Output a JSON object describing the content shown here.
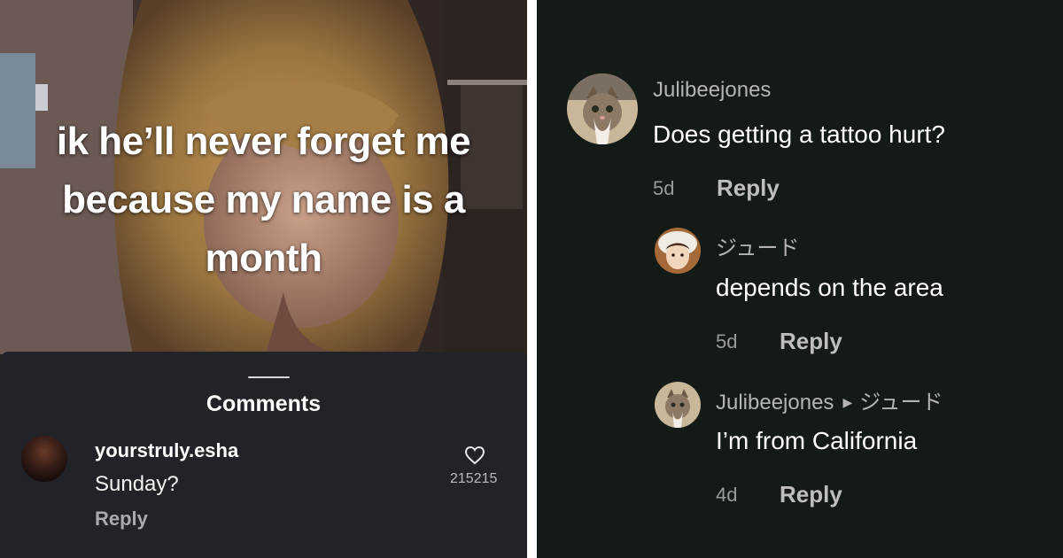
{
  "left_panel": {
    "caption_lines": [
      "ik he’ll never forget me",
      "because my name is a",
      "month"
    ],
    "comments_sheet": {
      "title": "Comments",
      "comment": {
        "username": "yourstruly.esha",
        "text": "Sunday?",
        "reply_label": "Reply",
        "likes": "215215",
        "like_icon": "heart-outline-icon"
      }
    }
  },
  "right_panel": {
    "comments": [
      {
        "username": "Julibeejones",
        "text": "Does getting a tattoo hurt?",
        "time": "5d",
        "reply_label": "Reply"
      },
      {
        "username": "ジュード",
        "text": "depends on the area",
        "time": "5d",
        "reply_label": "Reply"
      },
      {
        "username": "Julibeejones",
        "reply_to": "ジュード",
        "text": "I’m from California",
        "time": "4d",
        "reply_label": "Reply"
      }
    ]
  },
  "colors": {
    "left_sheet_bg": "#222328",
    "right_bg": "#141a16",
    "reply_gray": "#a9aab0"
  }
}
